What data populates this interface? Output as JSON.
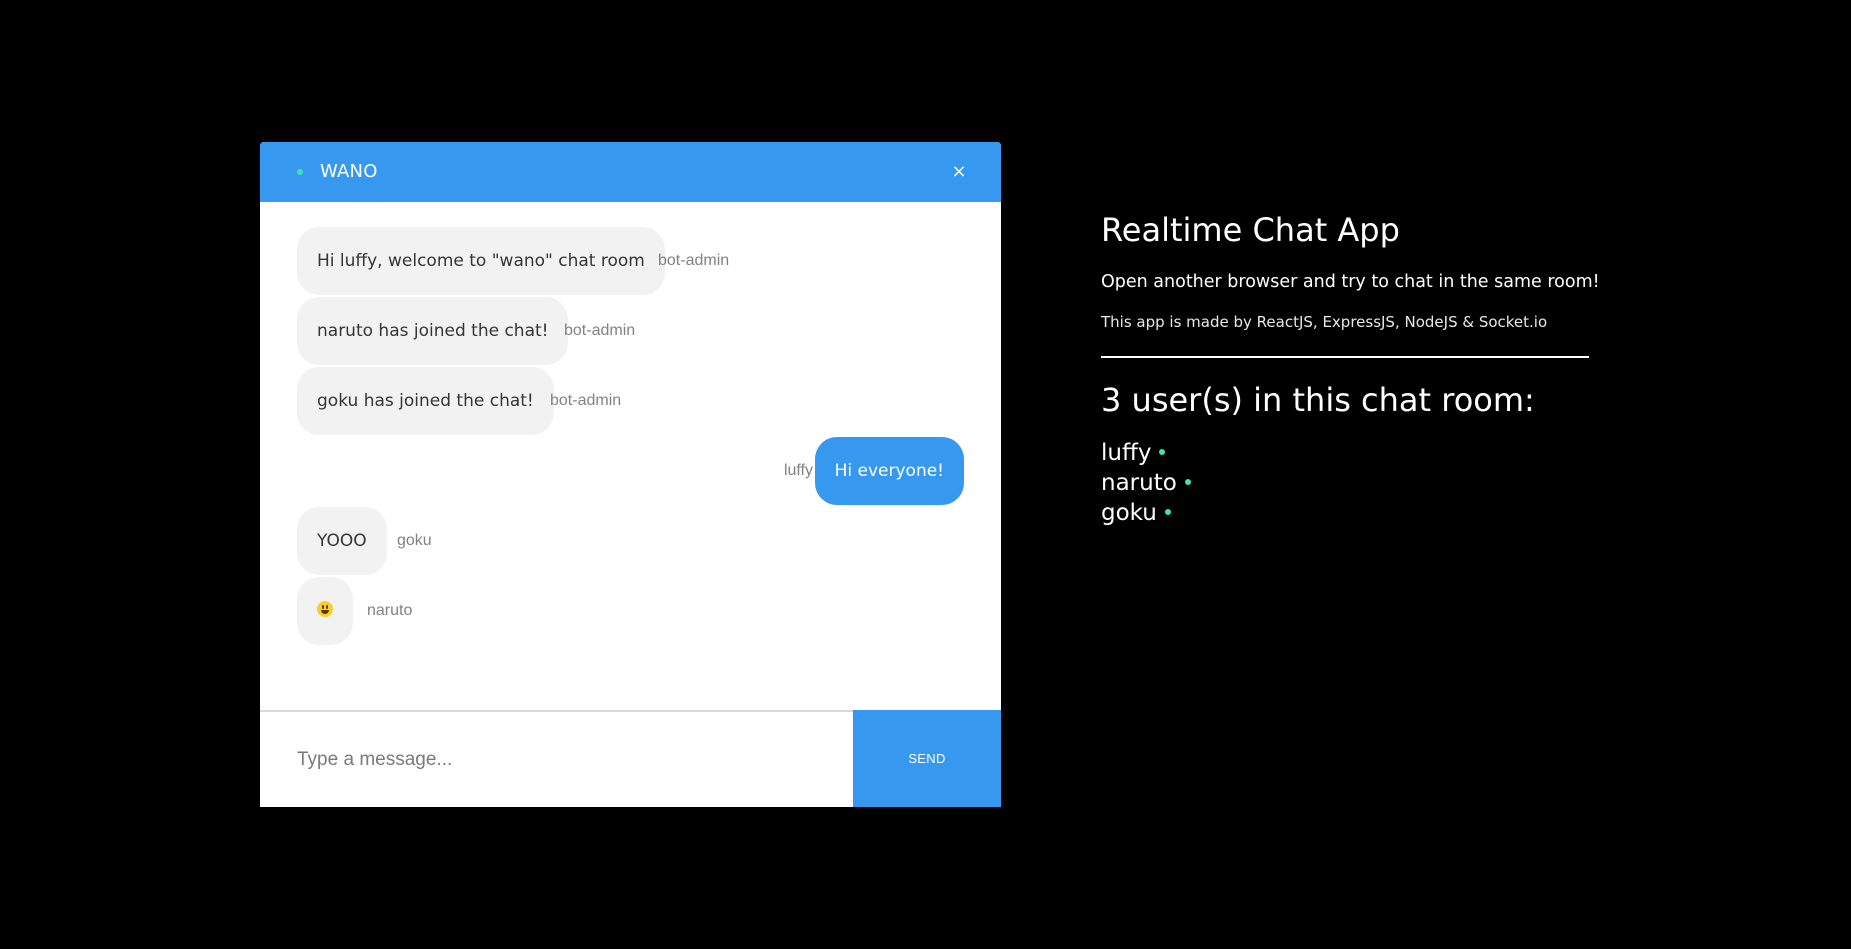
{
  "room": {
    "name": "WANO",
    "close_label": "×"
  },
  "messages": [
    {
      "text": "Hi luffy, welcome to \"wano\" chat room",
      "sender": "bot-admin",
      "own": false
    },
    {
      "text": "naruto has joined the chat!",
      "sender": "bot-admin",
      "own": false
    },
    {
      "text": "goku has joined the chat!",
      "sender": "bot-admin",
      "own": false
    },
    {
      "text": "Hi everyone!",
      "sender": "luffy",
      "own": true
    },
    {
      "text": "YOOO",
      "sender": "goku",
      "own": false
    },
    {
      "text": "",
      "icon": "grinning-face-emoji-icon",
      "sender": "naruto",
      "own": false
    }
  ],
  "composer": {
    "placeholder": "Type a message...",
    "value": "",
    "send_label": "SEND"
  },
  "info": {
    "title": "Realtime Chat App",
    "subtitle": "Open another browser and try to chat in the same room!",
    "credits": "This app is made by ReactJS, ExpressJS, NodeJS & Socket.io",
    "users_heading": "3 user(s) in this chat room:",
    "users": [
      "luffy",
      "naruto",
      "goku"
    ]
  },
  "colors": {
    "accent": "#3798f0",
    "online": "#3ce7a5",
    "bubble_incoming": "#f2f2f2",
    "background": "#000000"
  }
}
